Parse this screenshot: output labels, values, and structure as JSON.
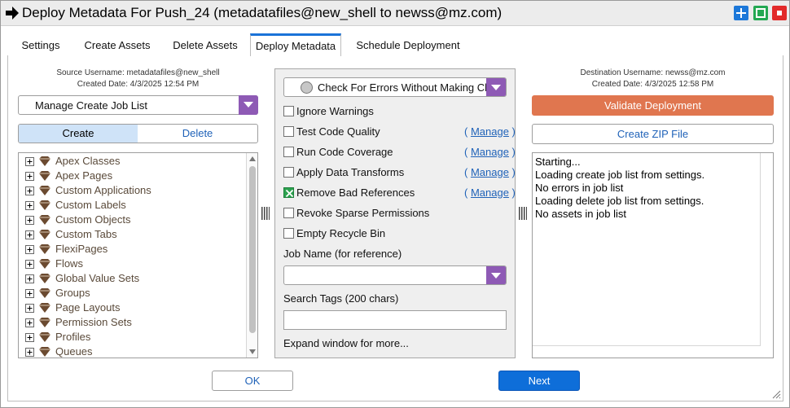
{
  "window": {
    "title": "Deploy Metadata For Push_24 (metadatafiles@new_shell to newss@mz.com)"
  },
  "tabs": [
    {
      "label": "Settings"
    },
    {
      "label": "Create Assets"
    },
    {
      "label": "Delete Assets"
    },
    {
      "label": "Deploy Metadata"
    },
    {
      "label": "Schedule Deployment"
    }
  ],
  "source": {
    "username": "Source Username: metadatafiles@new_shell",
    "created": "Created Date: 4/3/2025 12:54 PM"
  },
  "job_list_dropdown": {
    "value": "Manage Create Job List"
  },
  "segmented": {
    "create": "Create",
    "delete": "Delete"
  },
  "tree_items": [
    {
      "label": "Apex Classes"
    },
    {
      "label": "Apex Pages"
    },
    {
      "label": "Custom Applications"
    },
    {
      "label": "Custom Labels"
    },
    {
      "label": "Custom Objects"
    },
    {
      "label": "Custom Tabs"
    },
    {
      "label": "FlexiPages"
    },
    {
      "label": "Flows"
    },
    {
      "label": "Global Value Sets"
    },
    {
      "label": "Groups"
    },
    {
      "label": "Page Layouts"
    },
    {
      "label": "Permission Sets"
    },
    {
      "label": "Profiles"
    },
    {
      "label": "Queues"
    }
  ],
  "deploy_mode": {
    "value": "Check For Errors Without Making Changes"
  },
  "options": [
    {
      "label": "Ignore Warnings",
      "checked": false,
      "manage": ""
    },
    {
      "label": "Test Code Quality",
      "checked": false,
      "manage": "Manage"
    },
    {
      "label": "Run Code Coverage",
      "checked": false,
      "manage": "Manage"
    },
    {
      "label": "Apply Data Transforms",
      "checked": false,
      "manage": "Manage"
    },
    {
      "label": "Remove Bad References",
      "checked": true,
      "manage": "Manage"
    },
    {
      "label": "Revoke Sparse Permissions",
      "checked": false,
      "manage": ""
    },
    {
      "label": "Empty Recycle Bin",
      "checked": false,
      "manage": ""
    }
  ],
  "job_name": {
    "label": "Job Name (for reference)",
    "value": ""
  },
  "search_tags": {
    "label": "Search Tags (200 chars)",
    "value": ""
  },
  "expand_note": "Expand window for more...",
  "destination": {
    "username": "Destination Username: newss@mz.com",
    "created": "Created Date: 4/3/2025 12:58 PM"
  },
  "buttons": {
    "validate": "Validate Deployment",
    "zip": "Create ZIP File",
    "ok": "OK",
    "next": "Next"
  },
  "log_lines": [
    "Starting...",
    "Loading create job list from settings.",
    "No errors in job list",
    "Loading delete job list from settings.",
    "No assets in job list"
  ],
  "colors": {
    "accent_purple": "#8e5ab5",
    "validate_orange": "#e0764f",
    "next_blue": "#0e6ed9",
    "tab_active_blue": "#1a73d8",
    "checked_green": "#2ca24f"
  }
}
